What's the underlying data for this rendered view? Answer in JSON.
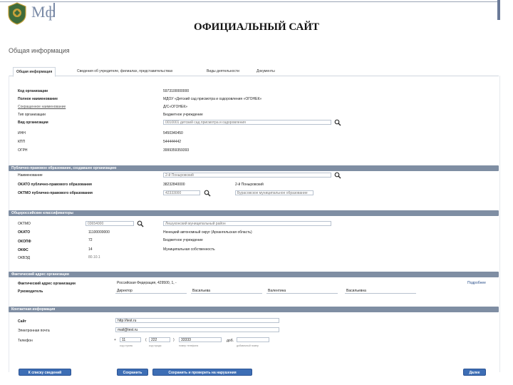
{
  "header": {
    "brand": "Мф",
    "slide_title": "ОФИЦИАЛЬНЫЙ САЙТ"
  },
  "page_heading": "Общая информация",
  "tabs": [
    {
      "label": "Общая информация",
      "active": true
    },
    {
      "label": "Сведения об учредителе, филиалах, представительствах",
      "active": false
    },
    {
      "label": "Виды деятельности",
      "active": false
    },
    {
      "label": "Документы",
      "active": false
    }
  ],
  "general": {
    "rows": [
      {
        "label": "Код организации",
        "value": "5973100000000"
      },
      {
        "label": "Полное наименование",
        "value": "МДОУ «Детский сад присмотра и оздоровления «ОГОНЕК»"
      },
      {
        "label": "Сокращенное наименование",
        "value": "Д/С«ОГОНЕК»"
      },
      {
        "label": "Тип организации",
        "value": "Бюджетное учреждение"
      },
      {
        "label": "Вид организации",
        "value": "0010001 детский сад присмотра и оздоровления"
      },
      {
        "label": "ИНН",
        "value": "5450340450"
      },
      {
        "label": "КПП",
        "value": "544444442"
      },
      {
        "label": "ОГРН",
        "value": "3999359359393"
      }
    ]
  },
  "municipal": {
    "title": "Публично-правовое образование, создавшее организацию",
    "name_label": "Наименование",
    "name_value": "2-й Поныровский",
    "okato_label": "ОКАТО публично-правового образования",
    "okato_value": "38232840000",
    "okato_name": "2-й Поныровский",
    "oktmo_label": "ОКТМО публично-правового образования",
    "oktmo_value": "42333000",
    "oktmo_name": "Бурасовское муниципальное образование"
  },
  "classifiers": {
    "title": "Общероссийские классификаторы",
    "oktmo_label": "ОКТМО",
    "oktmo_value": "03654000",
    "oktmo_name": "Лешуконский муниципальный район",
    "okato_label": "ОКАТО",
    "okato_value": "11100000000",
    "okato_name": "Ненецкий автономный округ (Архангельская область)",
    "okopf_label": "ОКОПФ",
    "okopf_value": "72",
    "okopf_name": "Бюджетное учреждение",
    "okfs_label": "ОКФС",
    "okfs_value": "14",
    "okfs_name": "Муниципальная собственность",
    "okved_label": "ОКВЭД",
    "okved_value": "80.10.1"
  },
  "address": {
    "title": "Фактический адрес организации",
    "addr_label": "Фактический адрес организации",
    "addr_value": "Российская Федерация, 429500, 1, -",
    "details_link": "Подробнее",
    "head_label": "Руководитель",
    "position": "Директор",
    "last_name": "Васильева",
    "first_name": "Валентина",
    "middle_name": "Васильевна"
  },
  "contacts": {
    "title": "Контактная информация",
    "site_label": "Сайт",
    "site_value": "http://test.ru",
    "email_label": "Электронная почта",
    "email_value": "mail@test.ru",
    "phone_label": "Телефон",
    "phone_country": "11",
    "phone_area": "222",
    "phone_number": "33333",
    "phone_ext_label": "доб.",
    "hint_country": "код страны",
    "hint_area": "код города",
    "hint_number": "номер телефона",
    "hint_ext": "добавочный номер"
  },
  "buttons": {
    "back": "К списку сведений",
    "save": "Сохранить",
    "save_check": "Сохранить и проверить на нарушения",
    "next": "Далее"
  },
  "colors": {
    "section_bar": "#7f8ea3",
    "button": "#3d6eb5",
    "brand": "#7a8aa6"
  }
}
